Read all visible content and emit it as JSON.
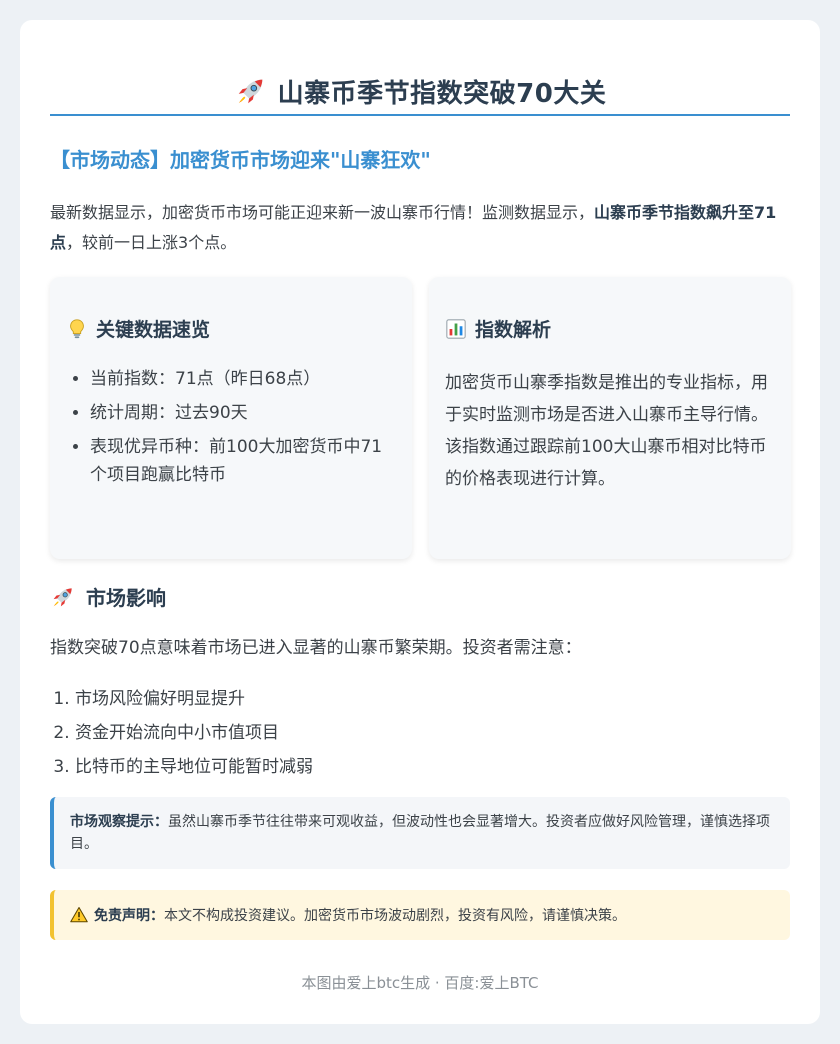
{
  "title": "山寨币季节指数突破70大关",
  "subheading": "【市场动态】加密货币市场迎来\"山寨狂欢\"",
  "intro": {
    "before": "最新数据显示，加密货币市场可能正迎来新一波山寨币行情！监测数据显示，",
    "bold": "山寨币季节指数飙升至71点",
    "after": "，较前一日上涨3个点。"
  },
  "key_data": {
    "title": "关键数据速览",
    "items": [
      "当前指数：71点（昨日68点）",
      "统计周期：过去90天",
      "表现优异币种：前100大加密货币中71个项目跑赢比特币"
    ]
  },
  "analysis": {
    "title": "指数解析",
    "text": "加密货币山寨季指数是推出的专业指标，用于实时监测市场是否进入山寨币主导行情。该指数通过跟踪前100大山寨币相对比特币的价格表现进行计算。"
  },
  "impact": {
    "title": "市场影响",
    "text": "指数突破70点意味着市场已进入显著的山寨币繁荣期。投资者需注意：",
    "items": [
      "市场风险偏好明显提升",
      "资金开始流向中小市值项目",
      "比特币的主导地位可能暂时减弱"
    ]
  },
  "tip": {
    "label": "市场观察提示：",
    "text": "虽然山寨币季节往往带来可观收益，但波动性也会显著增大。投资者应做好风险管理，谨慎选择项目。"
  },
  "disclaimer": {
    "label": "免责声明：",
    "text": "本文不构成投资建议。加密货币市场波动剧烈，投资有风险，请谨慎决策。"
  },
  "footer": "本图由爱上btc生成 · 百度:爱上BTC",
  "colors": {
    "accent": "#3a8fd0",
    "warning": "#f2c230",
    "background": "#edf1f5"
  },
  "icons": {
    "title": "rocket-icon",
    "key_data": "lightbulb-icon",
    "analysis": "bar-chart-icon",
    "impact": "rocket-icon",
    "disclaimer": "warning-icon"
  }
}
